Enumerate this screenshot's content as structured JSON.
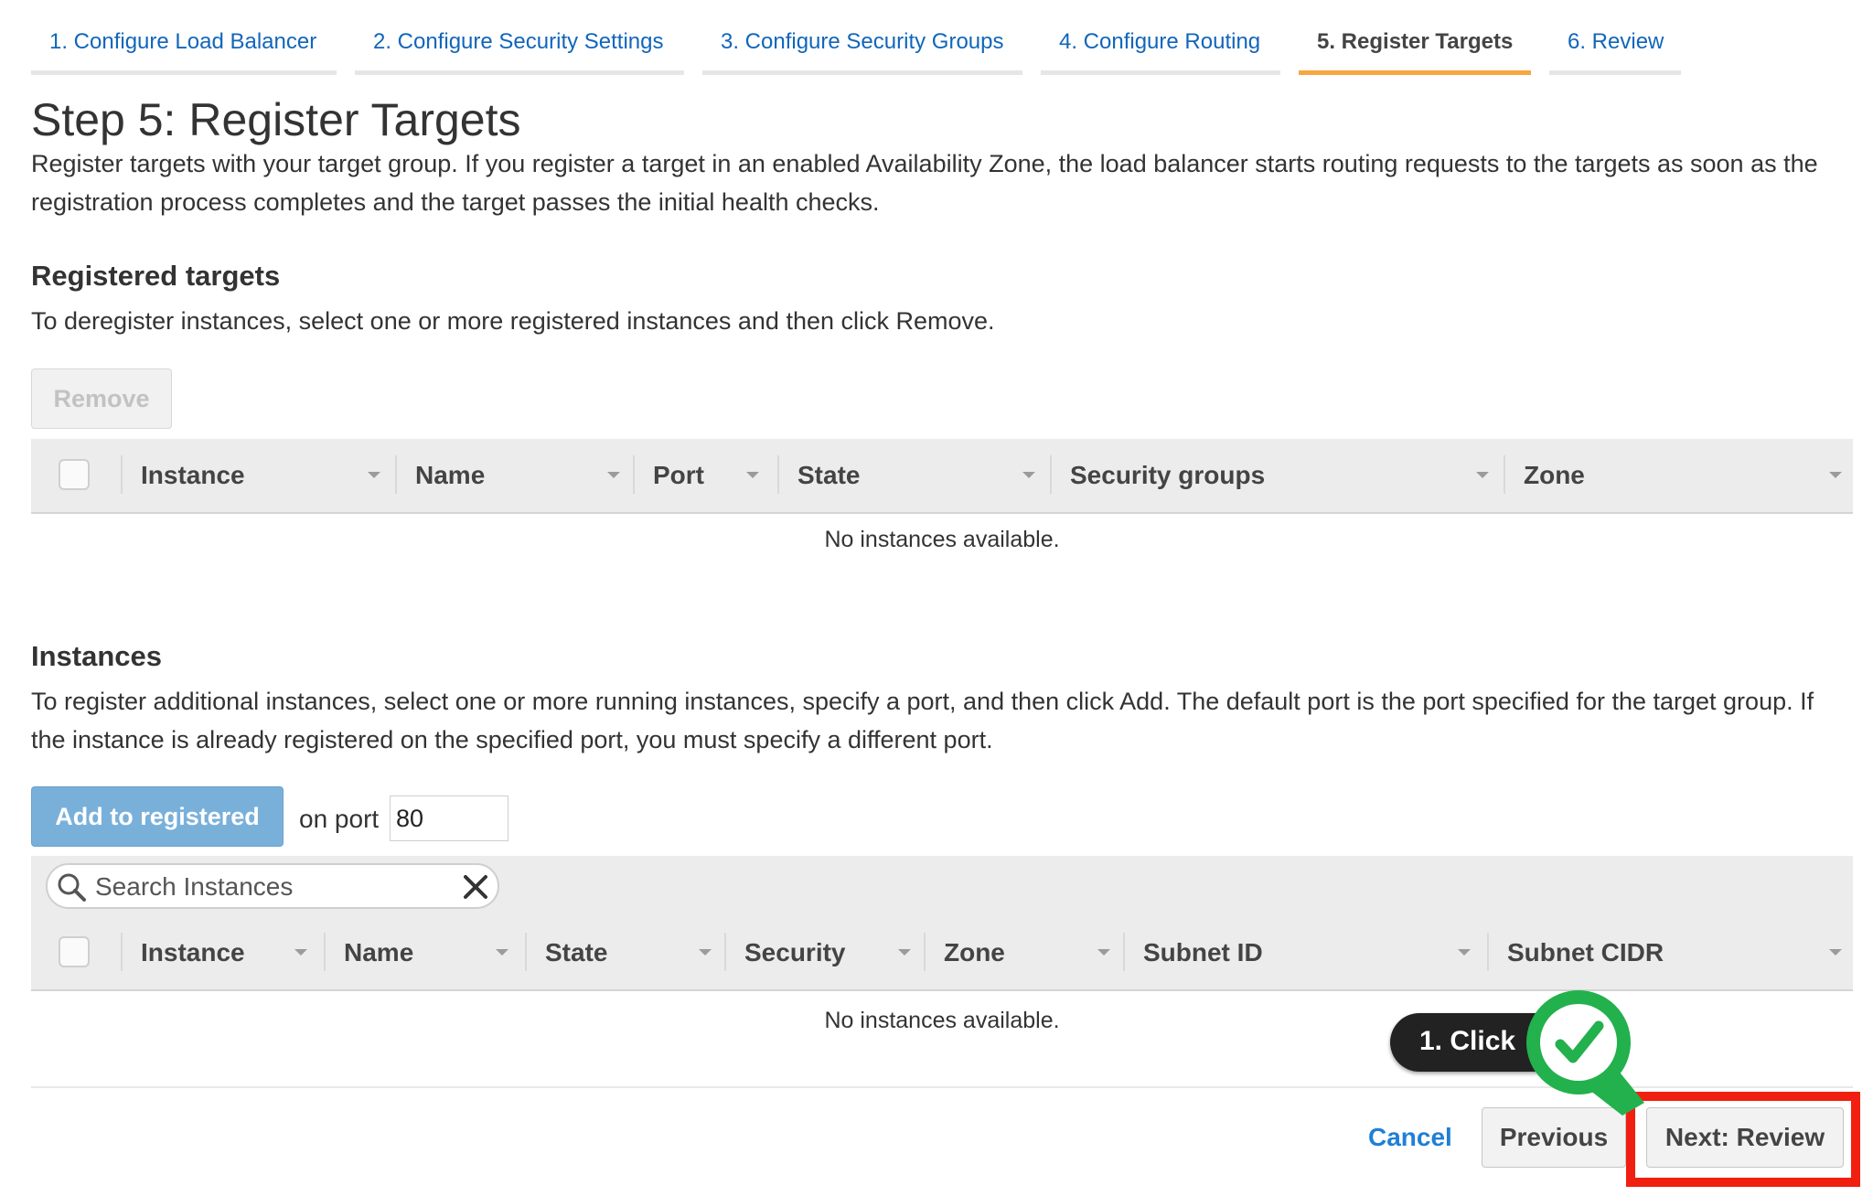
{
  "wizard": {
    "tabs": [
      {
        "label": "1. Configure Load Balancer"
      },
      {
        "label": "2. Configure Security Settings"
      },
      {
        "label": "3. Configure Security Groups"
      },
      {
        "label": "4. Configure Routing"
      },
      {
        "label": "5. Register Targets",
        "active": true
      },
      {
        "label": "6. Review"
      }
    ]
  },
  "page": {
    "title": "Step 5: Register Targets",
    "description": "Register targets with your target group. If you register a target in an enabled Availability Zone, the load balancer starts routing requests to the targets as soon as the registration process completes and the target passes the initial health checks."
  },
  "registered": {
    "heading": "Registered targets",
    "description": "To deregister instances, select one or more registered instances and then click Remove.",
    "remove_label": "Remove",
    "columns": [
      "Instance",
      "Name",
      "Port",
      "State",
      "Security groups",
      "Zone"
    ],
    "empty_text": "No instances available."
  },
  "instances": {
    "heading": "Instances",
    "description": "To register additional instances, select one or more running instances, specify a port, and then click Add. The default port is the port specified for the target group. If the instance is already registered on the specified port, you must specify a different port.",
    "add_label": "Add to registered",
    "on_port_label": "on port",
    "port_value": "80",
    "search_placeholder": "Search Instances",
    "columns": [
      "Instance",
      "Name",
      "State",
      "Security",
      "Zone",
      "Subnet ID",
      "Subnet CIDR"
    ],
    "empty_text": "No instances available."
  },
  "footer": {
    "cancel_label": "Cancel",
    "previous_label": "Previous",
    "next_label": "Next: Review"
  },
  "annotation": {
    "callout_text": "1. Click",
    "highlight_color": "#f01f0f",
    "check_color": "#22b14c"
  }
}
